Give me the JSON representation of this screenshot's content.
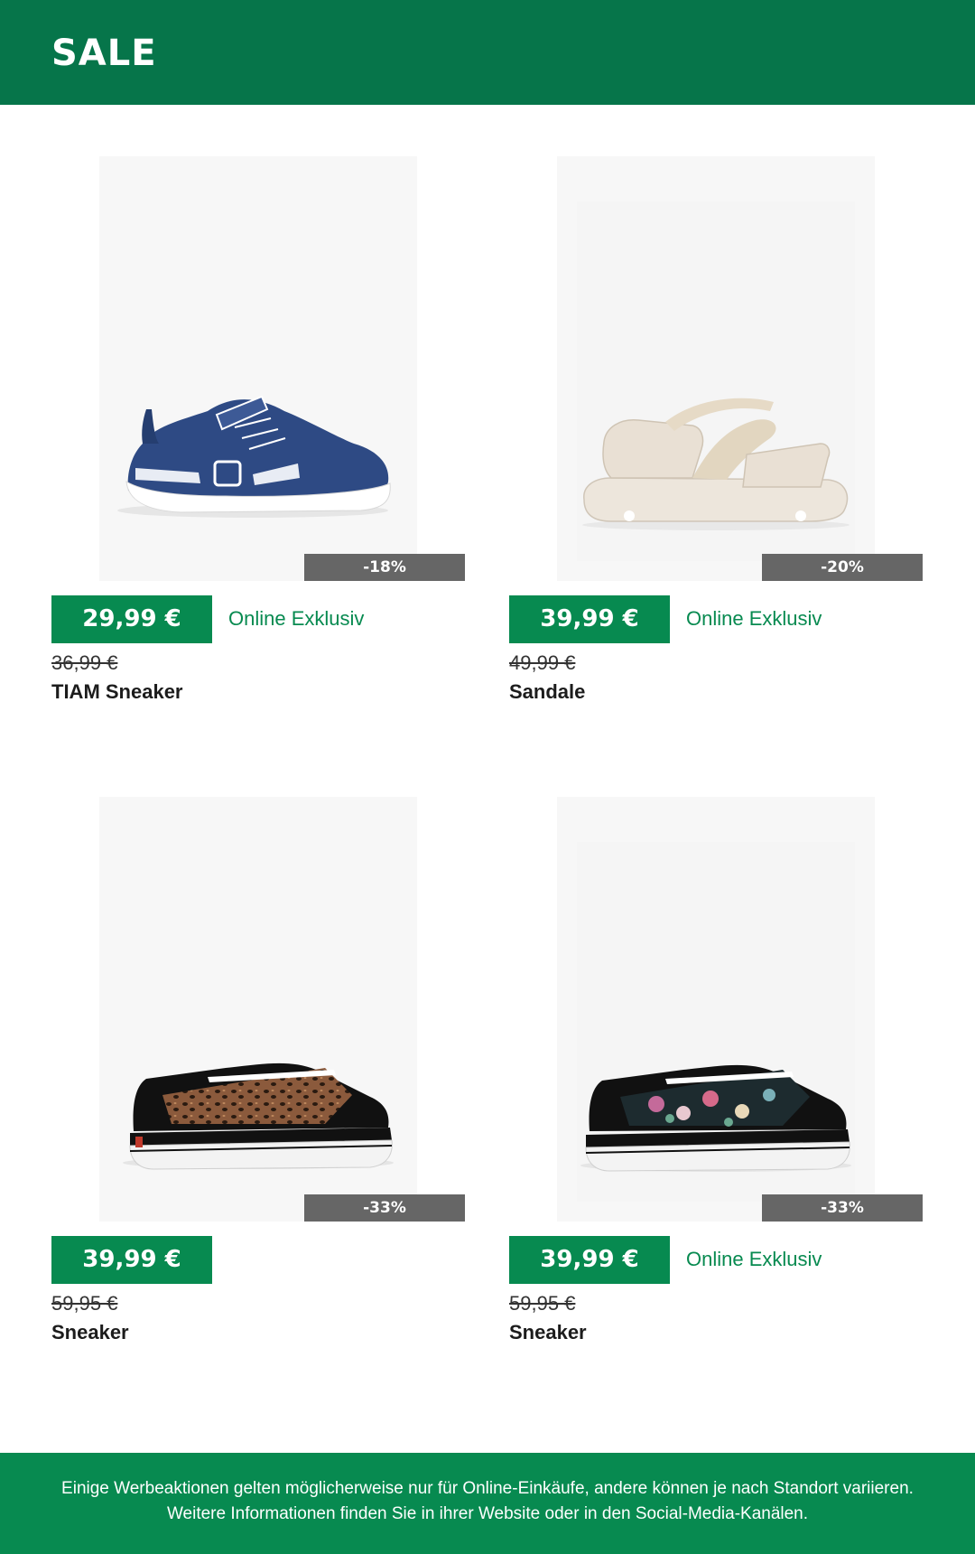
{
  "header": {
    "title": "SALE"
  },
  "colors": {
    "header_bg": "#06754a",
    "accent": "#078a50",
    "discount_bg": "#666666"
  },
  "products": [
    {
      "discount": "-18%",
      "price": "29,99 €",
      "badge": "Online Exklusiv",
      "old_price": "36,99 €",
      "name": "TIAM Sneaker",
      "image": "navy-kids-sneaker-icon"
    },
    {
      "discount": "-20%",
      "price": "39,99 €",
      "badge": "Online Exklusiv",
      "old_price": "49,99 €",
      "name": "Sandale",
      "image": "beige-sandal-icon"
    },
    {
      "discount": "-33%",
      "price": "39,99 €",
      "badge": "",
      "old_price": "59,95 €",
      "name": "Sneaker",
      "image": "leopard-sneaker-icon"
    },
    {
      "discount": "-33%",
      "price": "39,99 €",
      "badge": "Online Exklusiv",
      "old_price": "59,95 €",
      "name": "Sneaker",
      "image": "floral-sneaker-icon"
    }
  ],
  "footer": {
    "text": "Einige Werbeaktionen gelten möglicherweise nur für Online-Einkäufe, andere können je nach Standort variieren. Weitere Informationen finden Sie in ihrer Website oder in den Social-Media-Kanälen."
  }
}
